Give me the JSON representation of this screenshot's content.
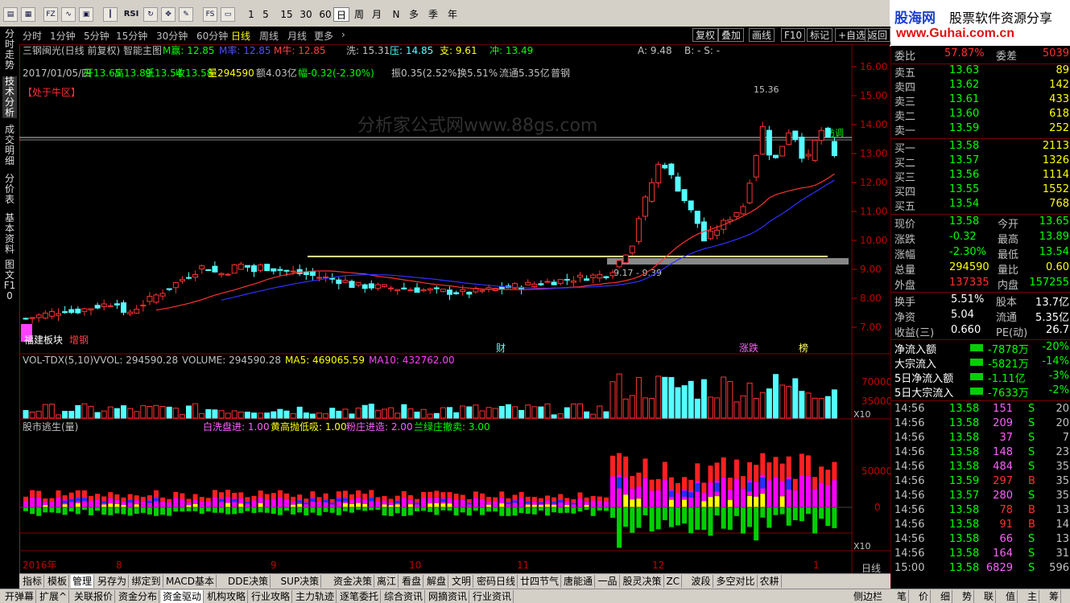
{
  "toolbar": {
    "zoom_numbers": [
      "1",
      "5",
      "15",
      "30",
      "60"
    ],
    "periods": [
      "日",
      "周",
      "月",
      "N",
      "多",
      "季",
      "年"
    ],
    "rsi_label": "RSI"
  },
  "logo": {
    "brand": "股海网",
    "tagline": "股票软件资源分享",
    "url": "www.Guhai.com.cn"
  },
  "left_tabs": [
    "分时走势",
    "技术分析",
    "成交明细",
    "分价表",
    "基本资料",
    "图文F10"
  ],
  "period_bar": {
    "items": [
      "分时",
      "1分钟",
      "5分钟",
      "15分钟",
      "30分钟",
      "60分钟",
      "日线",
      "周线",
      "月线",
      "更多"
    ],
    "active": "日线",
    "right_buttons": [
      "复权",
      "叠加",
      "画线",
      "F10",
      "标记",
      "+自选",
      "返回"
    ]
  },
  "main_header": {
    "name": "三钢闽光(日线 前复权) 智能主图",
    "ma_b": "M赢: 12.85",
    "ma_m": "M率: 12.85",
    "ma_n": "M牛: 12.85",
    "xi": "洗: 15.31",
    "ya": "压: 14.85",
    "zhi": "支: 9.61",
    "chong": "冲: 13.49",
    "a_val": "A: 9.48",
    "b_val": "B: -  S: -"
  },
  "info_line": {
    "date": "2017/01/05/四",
    "open": "开13.65",
    "high": "高13.89",
    "low": "低13.54",
    "close": "收13.58",
    "vol": "量294590",
    "amount": "额4.03亿",
    "change": "幅-0.32(-2.30%)",
    "amp": "振0.35(2.52%)",
    "turn": "换5.51%",
    "float": "流通5.35亿",
    "tag": "普钢"
  },
  "chart_tags": {
    "bull_zone": "【处于牛区】",
    "sector": "福建板块",
    "sector2": "增钢",
    "cai": "财",
    "zhangdie": "涨跌",
    "bang": "榜",
    "range_label": "9.17 - 9.39",
    "peak_label": "15.36",
    "tiaozheng": "防调",
    "watermark": "分析家公式网www.88gs.com"
  },
  "price_axis": [
    "16.00",
    "15.00",
    "14.00",
    "13.00",
    "12.00",
    "11.00",
    "10.00",
    "9.00",
    "8.00",
    "7.00"
  ],
  "vol_header": {
    "name": "VOL-TDX(5,10)",
    "vvol": "VVOL: 294590.28",
    "volume": "VOLUME: 294590.28",
    "ma5": "MA5: 469065.59",
    "ma10": "MA10: 432762.00"
  },
  "vol_axis": [
    "70000",
    "35000",
    "X10"
  ],
  "ind_header": {
    "name": "股市逃生(量)",
    "a": "白洗盘进: 1.00",
    "b": "黄高抛低吸: 1.00",
    "c": "粉庄进造: 2.00",
    "d": "兰绿庄撤卖: 3.00"
  },
  "ind_axis": [
    "50000",
    "0",
    "X10"
  ],
  "date_axis": [
    "2016年",
    "8",
    "9",
    "10",
    "11",
    "12",
    "1"
  ],
  "date_axis_right": "日线",
  "quote": {
    "webi": {
      "label": "委比",
      "value": "57.87%",
      "label2": "委差",
      "value2": "5039"
    },
    "asks": [
      {
        "label": "卖五",
        "price": "13.63",
        "vol": "89"
      },
      {
        "label": "卖四",
        "price": "13.62",
        "vol": "142"
      },
      {
        "label": "卖三",
        "price": "13.61",
        "vol": "433"
      },
      {
        "label": "卖二",
        "price": "13.60",
        "vol": "618"
      },
      {
        "label": "卖一",
        "price": "13.59",
        "vol": "252"
      }
    ],
    "bids": [
      {
        "label": "买一",
        "price": "13.58",
        "vol": "2113"
      },
      {
        "label": "买二",
        "price": "13.57",
        "vol": "1326"
      },
      {
        "label": "买三",
        "price": "13.56",
        "vol": "1114"
      },
      {
        "label": "买四",
        "price": "13.55",
        "vol": "1552"
      },
      {
        "label": "买五",
        "price": "13.54",
        "vol": "768"
      }
    ],
    "stats": [
      {
        "l1": "现价",
        "v1": "13.58",
        "l2": "今开",
        "v2": "13.65",
        "c1": "#00ff00",
        "c2": "#00ff00"
      },
      {
        "l1": "涨跌",
        "v1": "-0.32",
        "l2": "最高",
        "v2": "13.89",
        "c1": "#00ff00",
        "c2": "#00ff00"
      },
      {
        "l1": "涨幅",
        "v1": "-2.30%",
        "l2": "最低",
        "v2": "13.54",
        "c1": "#00ff00",
        "c2": "#00ff00"
      },
      {
        "l1": "总量",
        "v1": "294590",
        "l2": "量比",
        "v2": "0.60",
        "c1": "#ffff00",
        "c2": "#ffff00"
      },
      {
        "l1": "外盘",
        "v1": "137335",
        "l2": "内盘",
        "v2": "157255",
        "c1": "#ff3030",
        "c2": "#00ff00"
      }
    ],
    "stats2": [
      {
        "l1": "换手",
        "v1": "5.51%",
        "l2": "股本",
        "v2": "13.7亿"
      },
      {
        "l1": "净资",
        "v1": "5.04",
        "l2": "流通",
        "v2": "5.35亿"
      },
      {
        "l1": "收益(三)",
        "v1": "0.660",
        "l2": "PE(动)",
        "v2": "26.7"
      }
    ],
    "flows": [
      {
        "label": "净流入额",
        "value": "-7878万",
        "pct": "-20%"
      },
      {
        "label": "大宗流入",
        "value": "-5821万",
        "pct": "-14%"
      },
      {
        "label": "5日净流入额",
        "value": "-1.11亿",
        "pct": "-3%"
      },
      {
        "label": "5日大宗流入",
        "value": "-7633万",
        "pct": "-2%"
      }
    ],
    "ticks": [
      {
        "time": "14:56",
        "price": "13.58",
        "vol": "151",
        "bs": "S",
        "n": "20"
      },
      {
        "time": "14:56",
        "price": "13.58",
        "vol": "209",
        "bs": "S",
        "n": "20"
      },
      {
        "time": "14:56",
        "price": "13.58",
        "vol": "37",
        "bs": "S",
        "n": "7"
      },
      {
        "time": "14:56",
        "price": "13.58",
        "vol": "148",
        "bs": "S",
        "n": "23"
      },
      {
        "time": "14:56",
        "price": "13.58",
        "vol": "484",
        "bs": "S",
        "n": "35"
      },
      {
        "time": "14:56",
        "price": "13.59",
        "vol": "297",
        "bs": "B",
        "n": "35"
      },
      {
        "time": "14:56",
        "price": "13.57",
        "vol": "280",
        "bs": "S",
        "n": "35"
      },
      {
        "time": "14:56",
        "price": "13.58",
        "vol": "78",
        "bs": "B",
        "n": "13"
      },
      {
        "time": "14:56",
        "price": "13.58",
        "vol": "91",
        "bs": "B",
        "n": "14"
      },
      {
        "time": "14:56",
        "price": "13.58",
        "vol": "66",
        "bs": "S",
        "n": "13"
      },
      {
        "time": "14:56",
        "price": "13.58",
        "vol": "164",
        "bs": "S",
        "n": "31"
      },
      {
        "time": "15:00",
        "price": "13.58",
        "vol": "6829",
        "bs": "S",
        "n": "596"
      }
    ],
    "bottom_tabs": [
      "笔",
      "价",
      "细",
      "势",
      "联",
      "值",
      "主",
      "筹"
    ]
  },
  "bottom_bar1": [
    "指标",
    "模板",
    "管理",
    "另存为",
    "绑定到",
    "MACD基本",
    "DDE决策",
    "SUP决策",
    "资金决策",
    "离江",
    "看盘",
    "解盘",
    "文明",
    "密码日线",
    "廿四节气",
    "唐能通",
    "一品",
    "股灵决策",
    "ZC",
    "波段",
    "多空对比",
    "农耕"
  ],
  "bottom_bar1_active": "管理",
  "bottom_bar2": [
    "开弹幕",
    "扩展^",
    "关联报价",
    "资金分布",
    "资金驱动",
    "机构攻略",
    "行业攻略",
    "主力轨迹",
    "逐笔委托",
    "综合资讯",
    "网摘资讯",
    "行业资讯"
  ],
  "bottom_bar2_active": "资金驱动",
  "bottom_right": "侧边栏",
  "colors": {
    "up": "#ff3232",
    "down": "#54ffff",
    "bg": "#000000",
    "grid": "#800000"
  }
}
